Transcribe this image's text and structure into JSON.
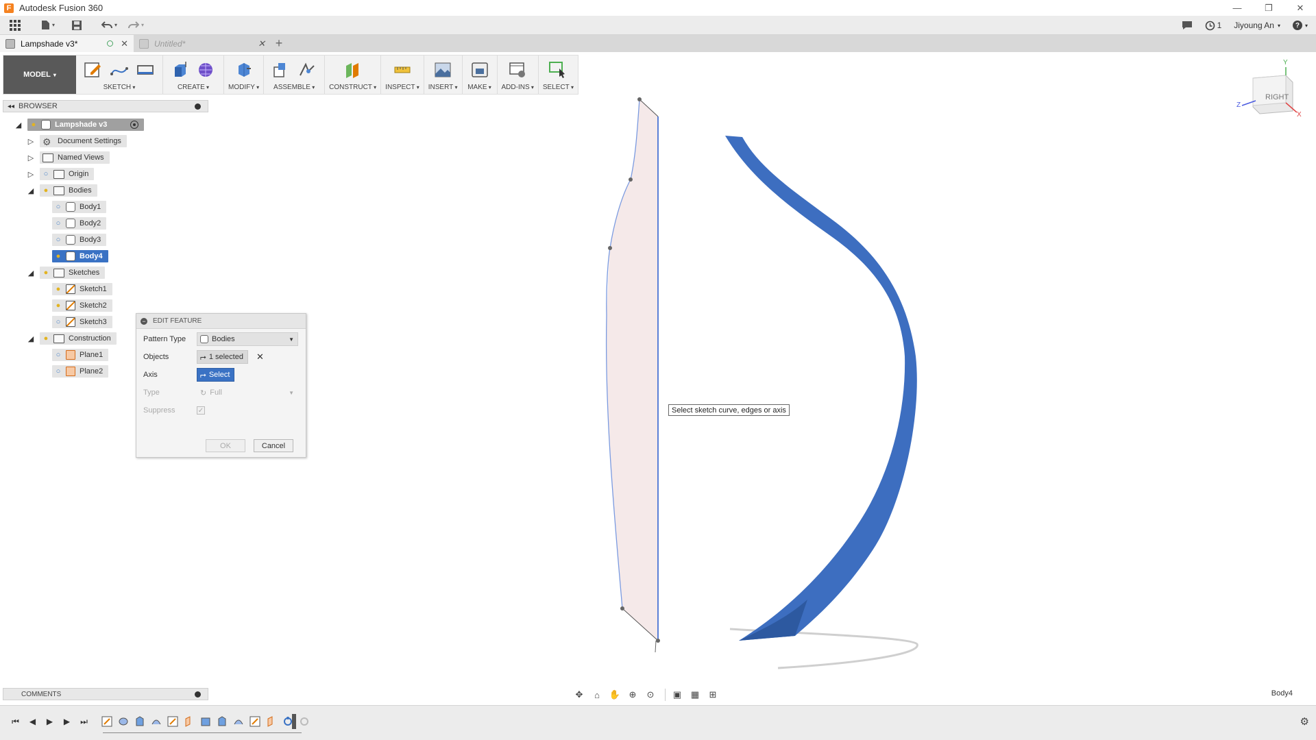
{
  "app": {
    "title": "Autodesk Fusion 360",
    "icon_letter": "F"
  },
  "window": {
    "minimize": "—",
    "restore": "❐",
    "close": "✕"
  },
  "quickaccess": {
    "notifications_count": "1",
    "user_name": "Jiyoung An",
    "help_label": "?"
  },
  "tabs": [
    {
      "label": "Lampshade v3*",
      "active": true
    },
    {
      "label": "Untitled*",
      "active": false
    }
  ],
  "toolbar": {
    "workspace": "MODEL",
    "groups": [
      "SKETCH",
      "CREATE",
      "MODIFY",
      "ASSEMBLE",
      "CONSTRUCT",
      "INSPECT",
      "INSERT",
      "MAKE",
      "ADD-INS",
      "SELECT"
    ]
  },
  "browser": {
    "title": "BROWSER",
    "root": "Lampshade v3",
    "items": {
      "document_settings": "Document Settings",
      "named_views": "Named Views",
      "origin": "Origin",
      "bodies": "Bodies",
      "body1": "Body1",
      "body2": "Body2",
      "body3": "Body3",
      "body4": "Body4",
      "sketches": "Sketches",
      "sketch1": "Sketch1",
      "sketch2": "Sketch2",
      "sketch3": "Sketch3",
      "construction": "Construction",
      "plane1": "Plane1",
      "plane2": "Plane2"
    }
  },
  "edit_feature": {
    "title": "EDIT FEATURE",
    "pattern_type_label": "Pattern Type",
    "pattern_type_value": "Bodies",
    "objects_label": "Objects",
    "objects_value": "1 selected",
    "axis_label": "Axis",
    "axis_value": "Select",
    "type_label": "Type",
    "type_value": "Full",
    "suppress_label": "Suppress",
    "ok_label": "OK",
    "cancel_label": "Cancel"
  },
  "viewport": {
    "tooltip": "Select sketch curve, edges or axis",
    "viewcube_face": "RIGHT",
    "axis_y": "Y",
    "axis_z": "Z",
    "axis_x": "X"
  },
  "comments": {
    "title": "COMMENTS"
  },
  "status": {
    "selection": "Body4"
  },
  "colors": {
    "accent_blue": "#3a72c4",
    "body_blue": "#3d6ec0",
    "sketch_fill": "#f5e9e9",
    "sketch_line": "#7a9ae0",
    "bulb_on": "#e2b321",
    "bulb_off": "#4b84c8"
  }
}
